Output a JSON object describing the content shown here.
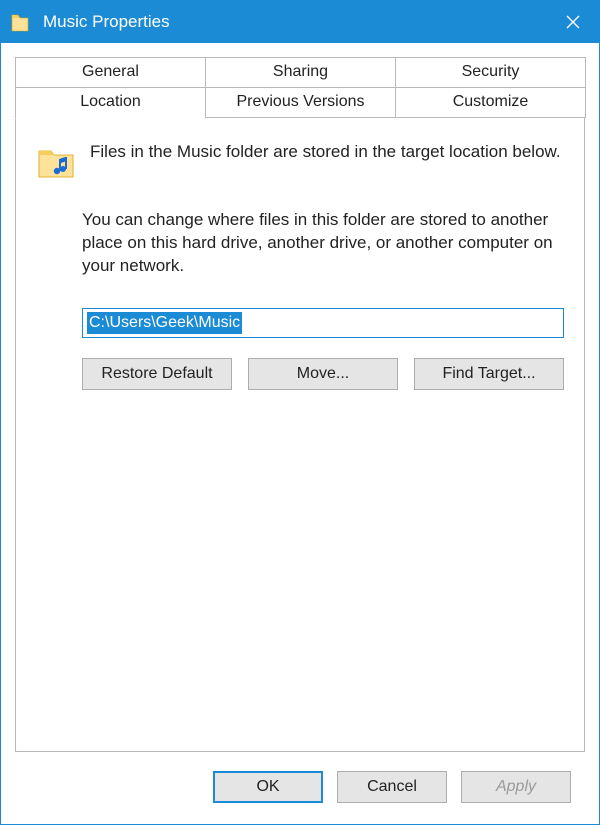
{
  "window": {
    "title": "Music Properties"
  },
  "tabs": {
    "row1": [
      {
        "label": "General"
      },
      {
        "label": "Sharing"
      },
      {
        "label": "Security"
      }
    ],
    "row2": [
      {
        "label": "Location",
        "active": true
      },
      {
        "label": "Previous Versions"
      },
      {
        "label": "Customize"
      }
    ]
  },
  "location_tab": {
    "intro": "Files in the Music folder are stored in the target location below.",
    "description": "You can change where files in this folder are stored to another place on this hard drive, another drive, or another computer on your network.",
    "path_value": "C:\\Users\\Geek\\Music",
    "buttons": {
      "restore": "Restore Default",
      "move": "Move...",
      "find": "Find Target..."
    }
  },
  "dialog_buttons": {
    "ok": "OK",
    "cancel": "Cancel",
    "apply": "Apply"
  },
  "icons": {
    "title_folder": "folder-icon",
    "music_folder": "music-folder-icon",
    "close": "close-icon"
  },
  "colors": {
    "accent": "#1b8bd6"
  }
}
